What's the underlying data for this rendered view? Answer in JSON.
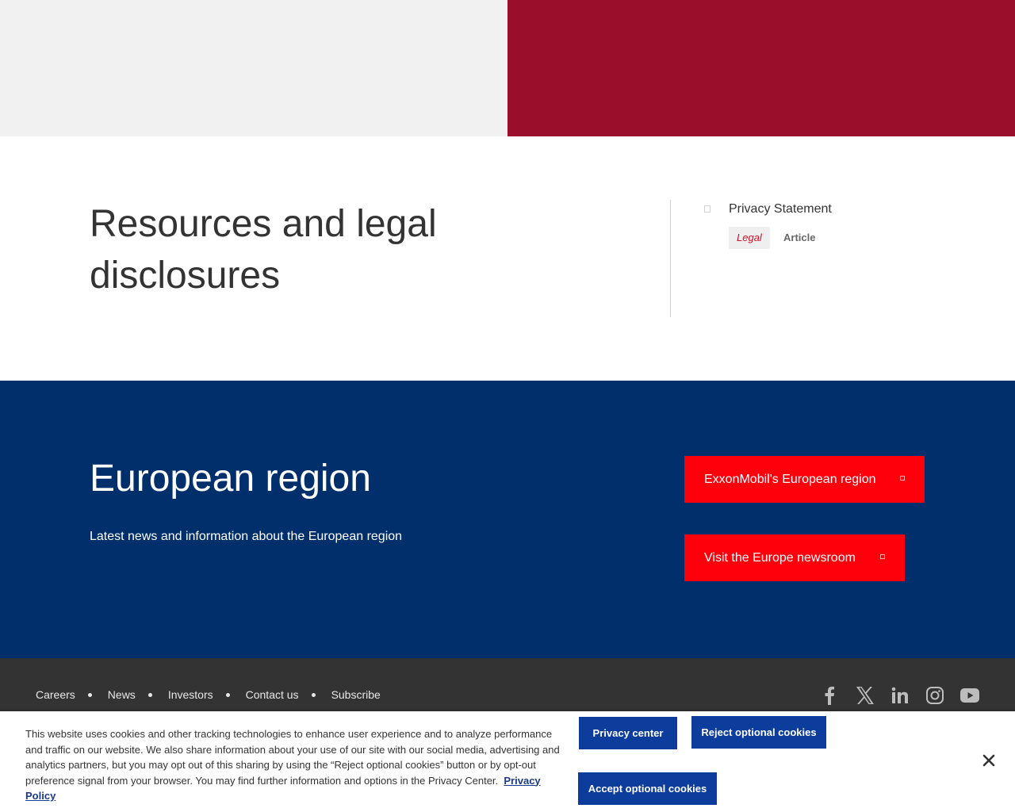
{
  "colors": {
    "hero_left": "#f0f1f0",
    "hero_right": "#9b0e2b",
    "region_bg": "#002f6c",
    "button_red": "#fe000c",
    "footer_bg": "#333333",
    "cookie_button": "#0c3c9c"
  },
  "resources": {
    "title": "Resources and legal disclosures",
    "item": {
      "icon": "document-icon",
      "label": "Privacy Statement",
      "tag": "Legal",
      "type": "Article"
    }
  },
  "region": {
    "title": "European region",
    "description": "Latest news and information about the European region",
    "buttons": [
      {
        "label": "ExxonMobil's European region",
        "icon": "external-link-icon"
      },
      {
        "label": "Visit the Europe newsroom",
        "icon": "external-link-icon"
      }
    ]
  },
  "footer": {
    "nav": [
      "Careers",
      "News",
      "Investors",
      "Contact us",
      "Subscribe"
    ],
    "social": [
      "facebook-icon",
      "x-icon",
      "linkedin-icon",
      "instagram-icon",
      "youtube-icon"
    ]
  },
  "cookie": {
    "text": "This website uses cookies and other tracking technologies to enhance user experience and to analyze performance and traffic on our website. We also share information about your use of our site with our social media, advertising and analytics partners, but you may opt out of this sharing by using the “Reject optional cookies” button or by opt-out preference signal from your browser. You may find further information and options in the Privacy Center.",
    "policy_link": "Privacy Policy",
    "privacy_center": "Privacy center",
    "reject": "Reject optional cookies",
    "accept": "Accept optional cookies",
    "close_icon": "close-icon"
  }
}
